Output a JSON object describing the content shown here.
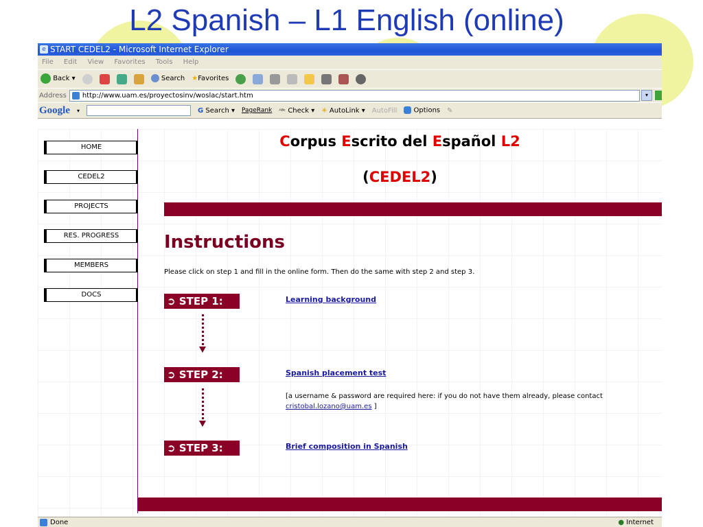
{
  "slide": {
    "title": "L2 Spanish – L1 English (online)"
  },
  "browser": {
    "window_title": "START CEDEL2 - Microsoft Internet Explorer",
    "menu": [
      "File",
      "Edit",
      "View",
      "Favorites",
      "Tools",
      "Help"
    ],
    "toolbar": {
      "back": "Back",
      "search": "Search",
      "favorites": "Favorites"
    },
    "address_label": "Address",
    "url": "http://www.uam.es/proyectosinv/woslac/start.htm",
    "google_bar": {
      "logo": "Google",
      "search": "Search",
      "pagerank": "PageRank",
      "check": "Check",
      "autolink": "AutoLink",
      "autofill": "AutoFill",
      "options": "Options"
    },
    "status": "Done",
    "zone": "Internet"
  },
  "page": {
    "nav": [
      "HOME",
      "CEDEL2",
      "PROJECTS",
      "RES. PROGRESS",
      "MEMBERS",
      "DOCS"
    ],
    "heading": {
      "c1": "C",
      "w1": "orpus ",
      "c2": "E",
      "w2": "scrito del ",
      "c3": "E",
      "w3": "spañol ",
      "c4": "L2"
    },
    "acronym": {
      "open": "(",
      "text": "CEDEL2",
      "close": ")"
    },
    "instructions_title": "Instructions",
    "intro": "Please click on step 1 and fill in the online form. Then do the same with step 2 and step 3.",
    "steps": [
      {
        "label": "➲ STEP 1:",
        "link": "Learning background"
      },
      {
        "label": "➲ STEP 2:",
        "link": "Spanish placement test"
      },
      {
        "label": "➲ STEP 3:",
        "link": "Brief composition in Spanish"
      }
    ],
    "note_text": "[a username & password are required here: if you do not have them already, please contact",
    "note_email": "cristobal.lozano@uam.es",
    "note_end": " ]"
  },
  "colors": {
    "title_blue": "#1f3ab5",
    "maroon": "#8b0027",
    "heading_red": "#e00000",
    "link_blue": "#1a1aa0"
  }
}
